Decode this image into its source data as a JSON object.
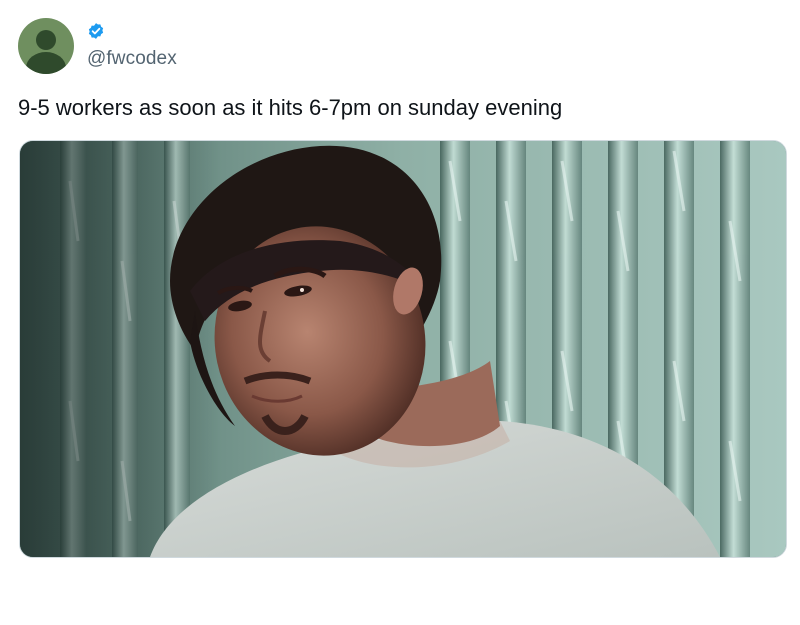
{
  "author": {
    "handle": "@fwcodex",
    "avatar_icon": "default-user-avatar-icon",
    "verified_icon": "verified-badge-icon",
    "verified_color": "#1d9bf0"
  },
  "tweet": {
    "text": "9-5 workers as soon as it hits 6-7pm on sunday evening"
  },
  "media": {
    "type": "image",
    "icon": "meme-image"
  },
  "colors": {
    "text_primary": "#0f1419",
    "text_secondary": "#536471",
    "background": "#ffffff"
  }
}
